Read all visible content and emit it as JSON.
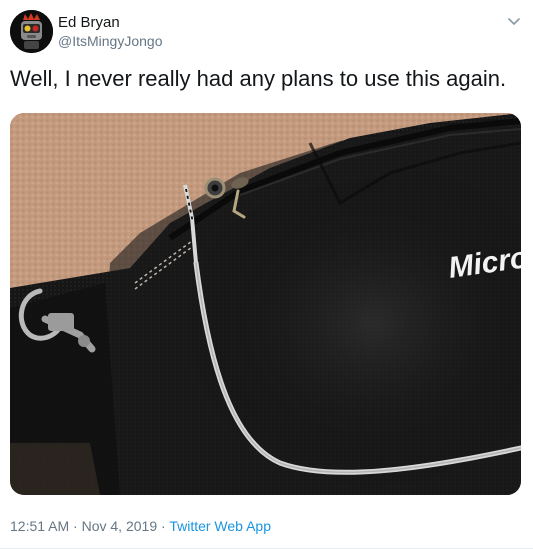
{
  "tweet": {
    "author_name": "Ed Bryan",
    "author_handle": "@ItsMingyJongo",
    "text": "Well, I never really had any plans to use this again.",
    "media": {
      "bag_brand_text": "Micro"
    },
    "time": "12:51 AM",
    "separator": "·",
    "date": "Nov 4, 2019",
    "source": "Twitter Web App"
  },
  "colors": {
    "link": "#1b95e0",
    "secondary_text": "#657786",
    "primary_text": "#14171a"
  },
  "icons": {
    "avatar": "robot-avatar",
    "menu": "chevron-down-icon"
  }
}
